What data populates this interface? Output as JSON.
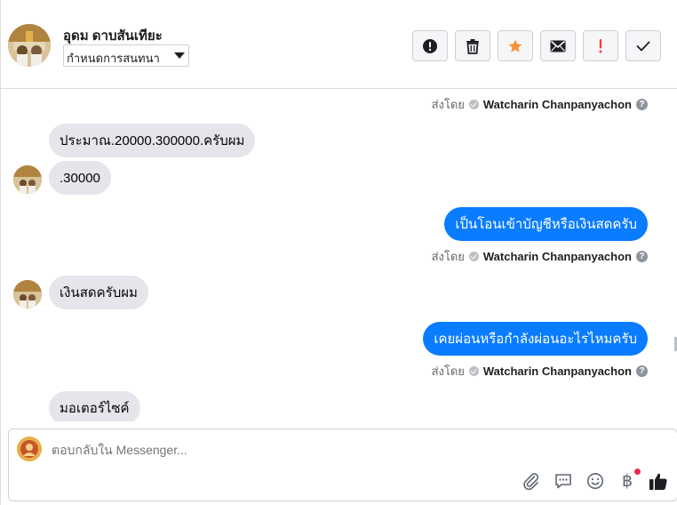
{
  "header": {
    "contact_name": "อุดม ดาบสันเทียะ",
    "assign_label": "กำหนดการสนทนา",
    "actions": [
      {
        "name": "report-spam-button",
        "icon": "exclamation-circle-icon"
      },
      {
        "name": "delete-button",
        "icon": "trash-icon"
      },
      {
        "name": "star-button",
        "icon": "star-icon"
      },
      {
        "name": "mark-unread-button",
        "icon": "envelope-icon"
      },
      {
        "name": "follow-up-button",
        "icon": "exclamation-icon"
      },
      {
        "name": "mark-done-button",
        "icon": "checkmark-icon"
      }
    ]
  },
  "thread": {
    "sent_by_prefix": "ส่งโดย",
    "sender_name": "Watcharin Chanpanyachon",
    "help_glyph": "?",
    "messages": [
      {
        "direction": "incoming",
        "text": "ประมาณ.20000.300000.ครับผม"
      },
      {
        "direction": "incoming",
        "text": ".30000"
      },
      {
        "direction": "outgoing",
        "text": "เป็นโอนเข้าบัญชีหรือเงินสดครับ"
      },
      {
        "direction": "incoming",
        "text": "เงินสดครับผม"
      },
      {
        "direction": "outgoing",
        "text": "เคยผ่อนหรือกำลังผ่อนอะไรไหมครับ"
      },
      {
        "direction": "incoming",
        "text": "มอเตอร์ไซค์"
      }
    ]
  },
  "composer": {
    "placeholder": "ตอบกลับใน Messenger...",
    "currency_glyph": "฿",
    "tools": [
      "paperclip-icon",
      "saved-reply-icon",
      "emoji-icon",
      "baht-payment-icon",
      "thumbs-up-icon"
    ]
  },
  "colors": {
    "outgoing_bubble": "#0a7cff",
    "incoming_bubble": "#e4e6eb",
    "star": "#f7923b",
    "follow_up": "#fa3e3e",
    "notification": "#f02849"
  }
}
